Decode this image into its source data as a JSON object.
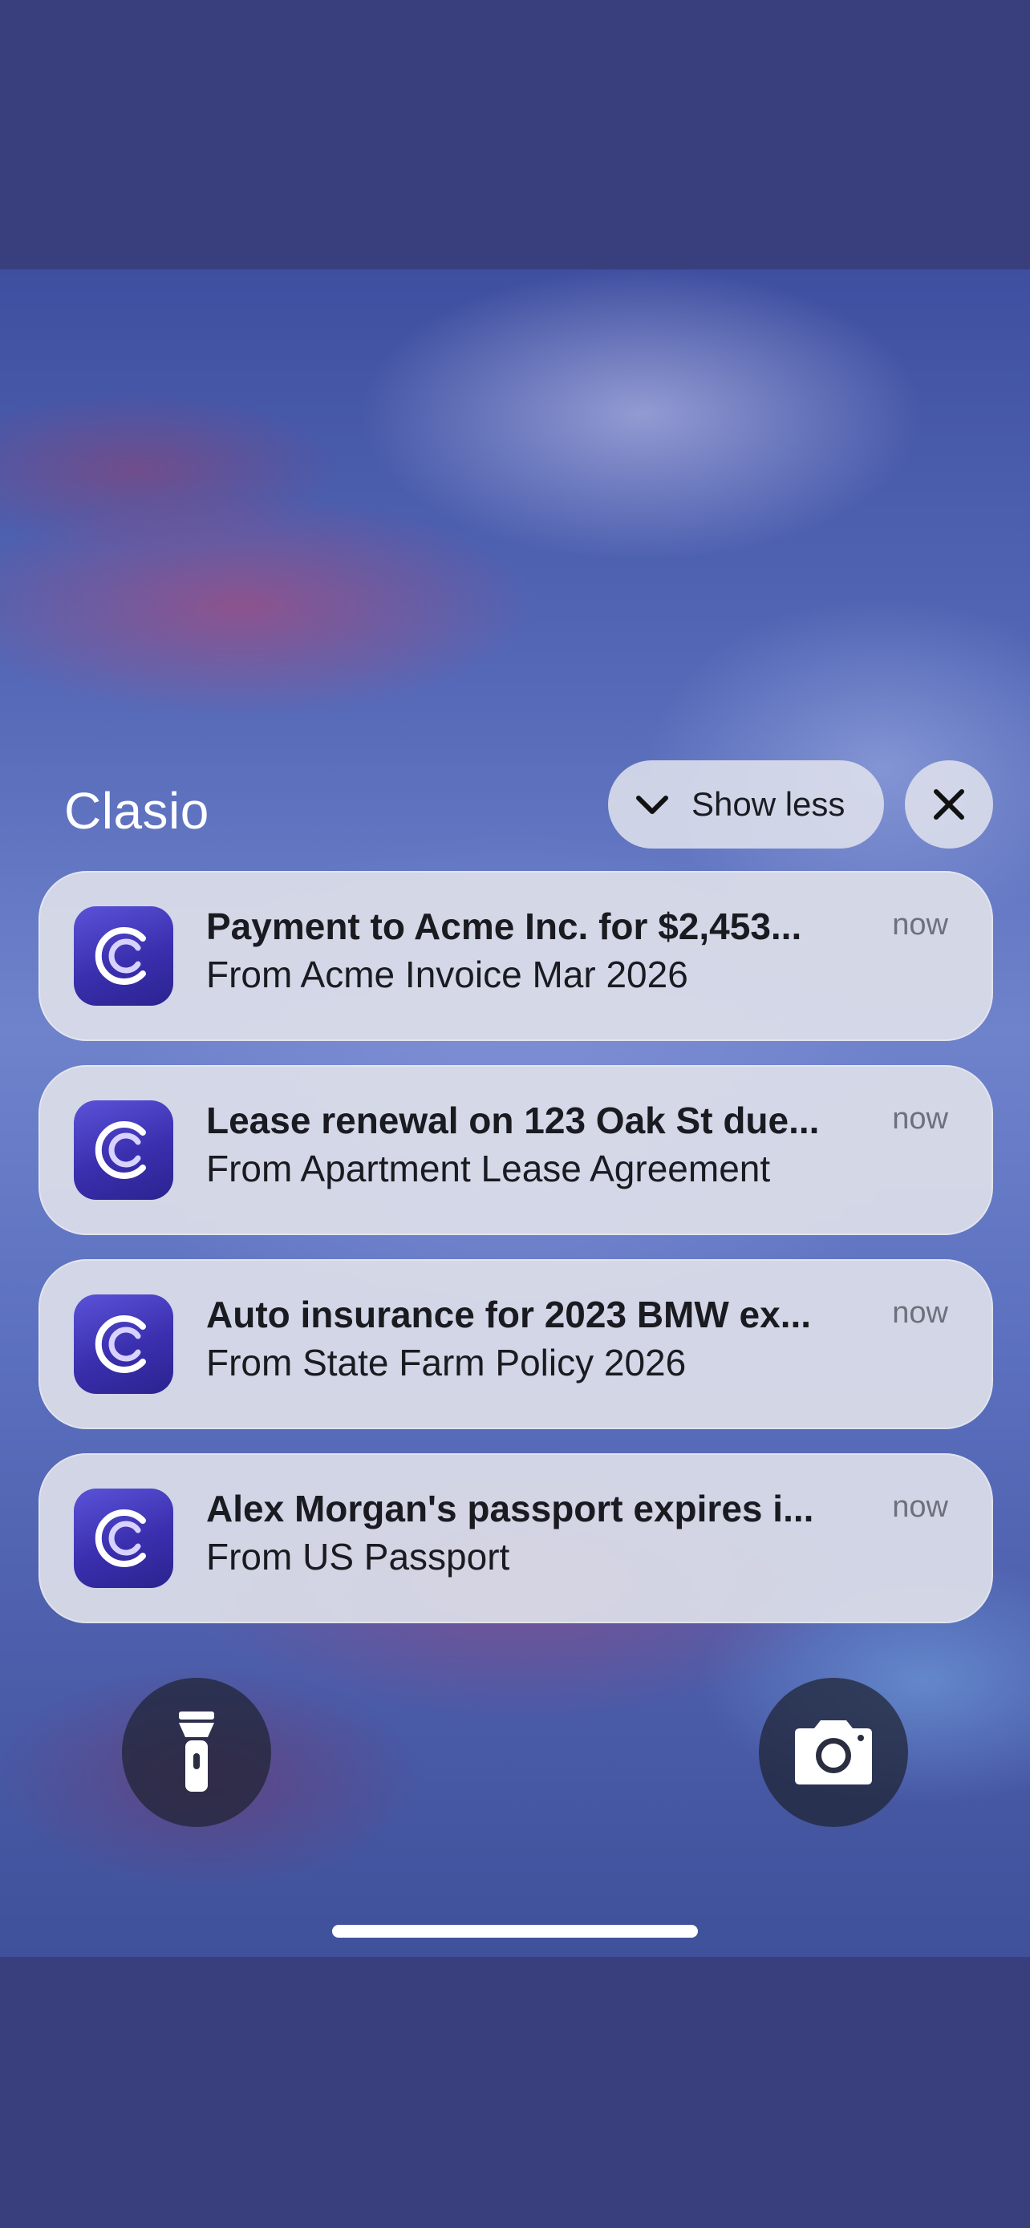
{
  "header": {
    "app_name": "Clasio",
    "show_less_label": "Show less"
  },
  "notifications": [
    {
      "title": "Payment to Acme Inc. for $2,453...",
      "body": "From Acme Invoice Mar 2026",
      "time": "now",
      "icon": "clasio-app-icon"
    },
    {
      "title": "Lease renewal on 123 Oak St due...",
      "body": "From Apartment Lease Agreement",
      "time": "now",
      "icon": "clasio-app-icon"
    },
    {
      "title": "Auto insurance for 2023 BMW ex...",
      "body": "From State Farm Policy 2026",
      "time": "now",
      "icon": "clasio-app-icon"
    },
    {
      "title": "Alex Morgan's passport expires i...",
      "body": "From US Passport",
      "time": "now",
      "icon": "clasio-app-icon"
    }
  ],
  "quick_actions": {
    "left": "flashlight-icon",
    "right": "camera-icon"
  },
  "colors": {
    "outer_background": "#383f7c",
    "app_icon": "#3a2fae",
    "notification_card": "#dcdee8"
  }
}
